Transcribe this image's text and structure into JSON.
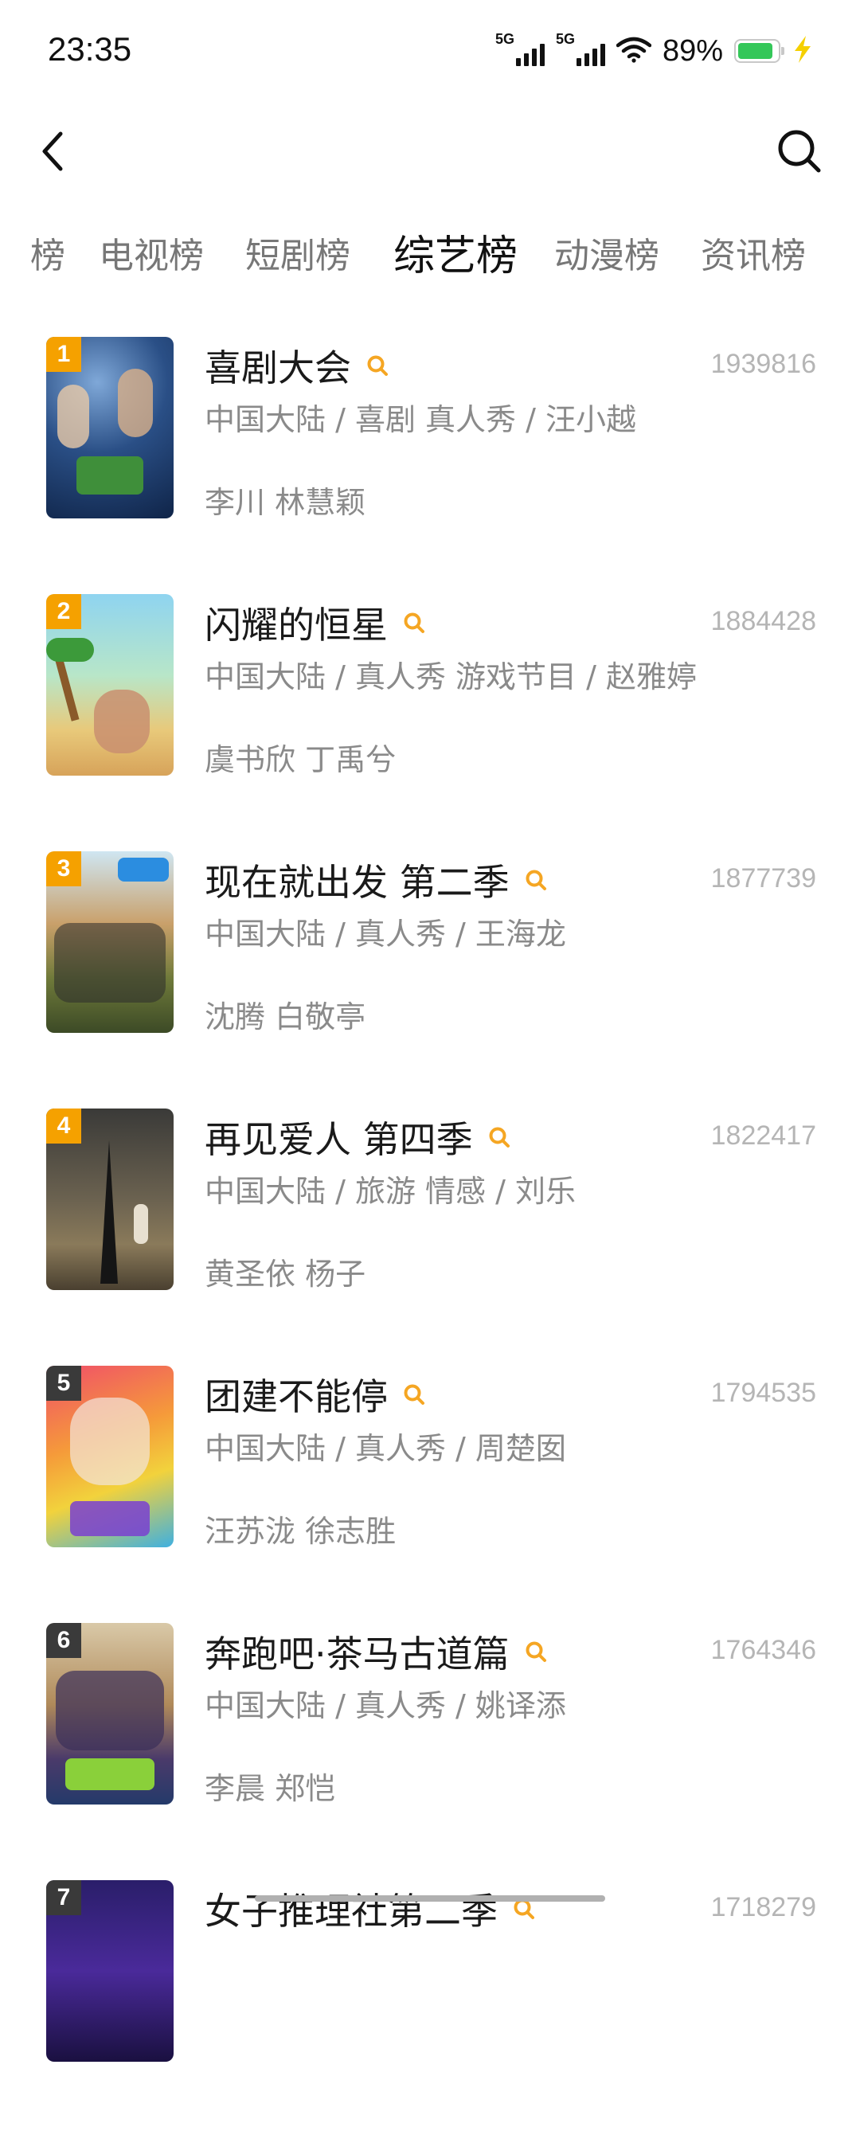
{
  "status_bar": {
    "time": "23:35",
    "network_1": "5G",
    "network_2": "5G",
    "battery": "89%"
  },
  "header": {
    "back_icon": "chevron-left-icon",
    "search_icon": "search-icon"
  },
  "tabs": [
    {
      "label": "榜",
      "active": false
    },
    {
      "label": "电视榜",
      "active": false
    },
    {
      "label": "短剧榜",
      "active": false
    },
    {
      "label": "综艺榜",
      "active": true
    },
    {
      "label": "动漫榜",
      "active": false
    },
    {
      "label": "资讯榜",
      "active": false
    }
  ],
  "colors": {
    "rank_orange": "#f5a100",
    "rank_dark": "#333333",
    "accent": "#f5a623",
    "battery_green": "#34c759"
  },
  "items": [
    {
      "rank": "1",
      "title": "喜剧大会",
      "score": "1939816",
      "meta": "中国大陆 / 喜剧 真人秀 / 汪小越",
      "cast": "李川 林慧颖"
    },
    {
      "rank": "2",
      "title": "闪耀的恒星",
      "score": "1884428",
      "meta": "中国大陆 / 真人秀 游戏节目 / 赵雅婷",
      "cast": "虞书欣 丁禹兮"
    },
    {
      "rank": "3",
      "title": "现在就出发 第二季",
      "score": "1877739",
      "meta": "中国大陆 / 真人秀 / 王海龙",
      "cast": "沈腾 白敬亭"
    },
    {
      "rank": "4",
      "title": "再见爱人 第四季",
      "score": "1822417",
      "meta": "中国大陆 / 旅游 情感 / 刘乐",
      "cast": "黄圣依 杨子"
    },
    {
      "rank": "5",
      "title": "团建不能停",
      "score": "1794535",
      "meta": "中国大陆 / 真人秀 / 周楚囡",
      "cast": "汪苏泷 徐志胜"
    },
    {
      "rank": "6",
      "title": "奔跑吧·茶马古道篇",
      "score": "1764346",
      "meta": "中国大陆 / 真人秀 / 姚译添",
      "cast": "李晨 郑恺"
    },
    {
      "rank": "7",
      "title": "女子推理社第二季",
      "score": "1718279",
      "meta": "",
      "cast": ""
    }
  ]
}
